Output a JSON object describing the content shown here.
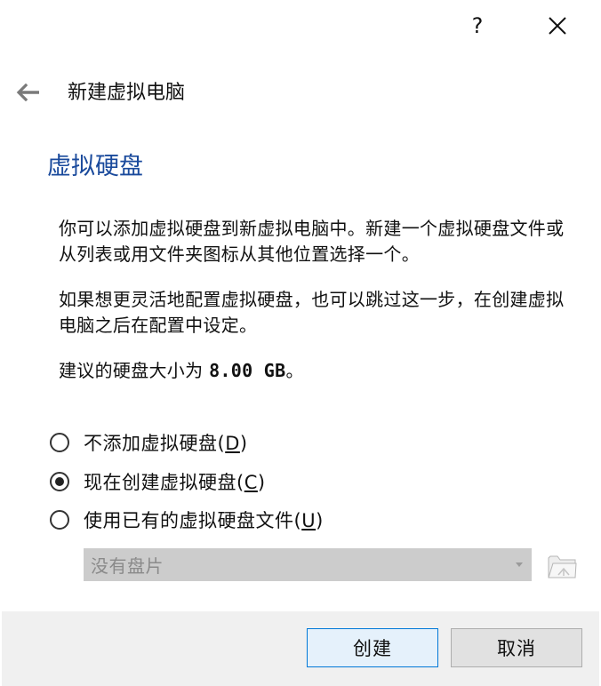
{
  "titlebar": {
    "help_label": "?",
    "close_icon": "close-icon"
  },
  "header": {
    "back_icon": "arrow-left-icon",
    "title": "新建虚拟电脑"
  },
  "page": {
    "heading": "虚拟硬盘",
    "paragraph1": "你可以添加虚拟硬盘到新虚拟电脑中。新建一个虚拟硬盘文件或从列表或用文件夹图标从其他位置选择一个。",
    "paragraph2": "如果想更灵活地配置虚拟硬盘，也可以跳过这一步，在创建虚拟电脑之后在配置中设定。",
    "recommended_prefix": "建议的硬盘大小为 ",
    "recommended_size": "8.00 GB",
    "recommended_suffix": "。"
  },
  "options": [
    {
      "label": "不添加虚拟硬盘",
      "paren_open": "(",
      "hotkey": "D",
      "paren_close": ")",
      "checked": false
    },
    {
      "label": "现在创建虚拟硬盘",
      "paren_open": "(",
      "hotkey": "C",
      "paren_close": ")",
      "checked": true
    },
    {
      "label": "使用已有的虚拟硬盘文件",
      "paren_open": "(",
      "hotkey": "U",
      "paren_close": ")",
      "checked": false
    }
  ],
  "disk_select": {
    "value": "没有盘片",
    "disabled": true,
    "folder_icon": "folder-open-icon"
  },
  "footer": {
    "create_label": "创建",
    "cancel_label": "取消"
  },
  "colors": {
    "heading": "#1a4a9c",
    "default_button_border": "#0078d7",
    "footer_bg": "#f0f0f0"
  }
}
